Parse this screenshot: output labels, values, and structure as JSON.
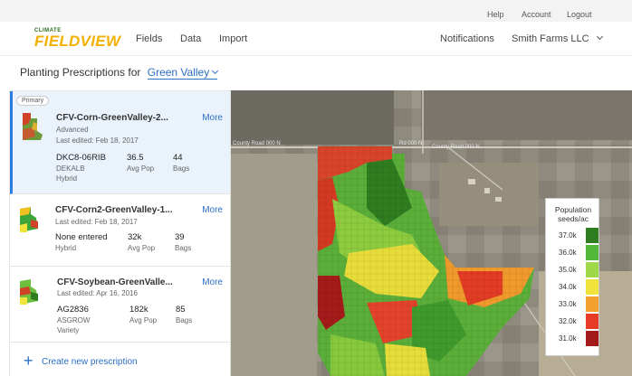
{
  "utility": {
    "help": "Help",
    "account": "Account",
    "logout": "Logout"
  },
  "logo": {
    "small": "CLIMATE",
    "main": "FIELDVIEW"
  },
  "nav": {
    "fields": "Fields",
    "data": "Data",
    "import": "Import",
    "notifications": "Notifications",
    "account_menu": "Smith Farms LLC"
  },
  "title": {
    "prefix": "Planting Prescriptions for",
    "field": "Green Valley"
  },
  "prescriptions": [
    {
      "badge": "Primary",
      "name": "CFV-Corn-GreenValley-2...",
      "more": "More",
      "type": "Advanced",
      "edited": "Last edited: Feb 18, 2017",
      "product": "DKC8-06RIB",
      "brand": "DEKALB",
      "kind": "Hybrid",
      "pop": "36.5",
      "pop_label": "Avg Pop",
      "bags": "44",
      "bags_label": "Bags"
    },
    {
      "name": "CFV-Corn2-GreenValley-1...",
      "more": "More",
      "edited": "Last edited: Feb 18, 2017",
      "product": "None entered",
      "kind": "Hybrid",
      "pop": "32k",
      "pop_label": "Avg Pop",
      "bags": "39",
      "bags_label": "Bags"
    },
    {
      "name": "CFV-Soybean-GreenValle...",
      "more": "More",
      "edited": "Last edited: Apr 16, 2016",
      "product": "AG2836",
      "brand": "ASGROW",
      "kind": "Variety",
      "pop": "182k",
      "pop_label": "Avg Pop",
      "bags": "85",
      "bags_label": "Bags"
    }
  ],
  "create": "Create new prescription",
  "map": {
    "roads": [
      "County Road 000 N",
      "Rd 000 N",
      "County Road 000 N"
    ],
    "legend": {
      "title": "Population",
      "subtitle": "seeds/ac",
      "rows": [
        {
          "label": "37.0k",
          "color": "#2e7d1f"
        },
        {
          "label": "36.0k",
          "color": "#52b83a"
        },
        {
          "label": "35.0k",
          "color": "#9fd94a"
        },
        {
          "label": "34.0k",
          "color": "#f2e23c"
        },
        {
          "label": "33.0k",
          "color": "#f3a12e"
        },
        {
          "label": "32.0k",
          "color": "#e83b25"
        },
        {
          "label": "31.0k",
          "color": "#a31a1a"
        }
      ]
    }
  }
}
